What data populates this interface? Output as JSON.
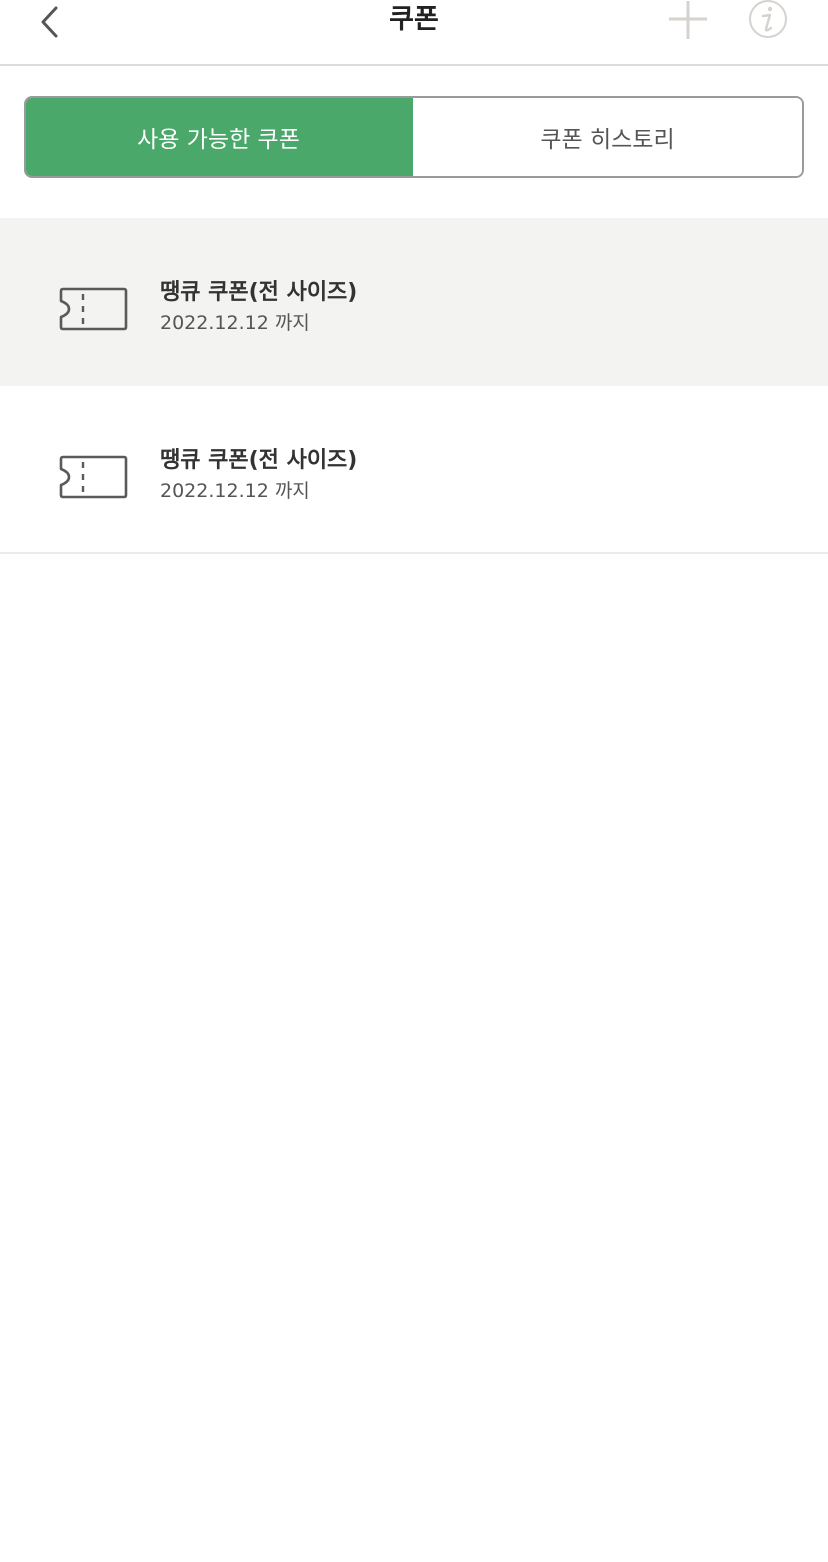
{
  "header": {
    "title": "쿠폰",
    "back_icon": "chevron-left-icon",
    "add_icon": "plus-icon",
    "info_icon": "info-icon"
  },
  "tabs": [
    {
      "label": "사용 가능한 쿠폰",
      "active": true
    },
    {
      "label": "쿠폰 히스토리",
      "active": false
    }
  ],
  "coupons": [
    {
      "name": "땡큐 쿠폰(전 사이즈)",
      "expiry": "2022.12.12 까지",
      "icon": "ticket-icon"
    },
    {
      "name": "땡큐 쿠폰(전 사이즈)",
      "expiry": "2022.12.12 까지",
      "icon": "ticket-icon"
    }
  ],
  "colors": {
    "accent": "#4aa86a",
    "highlight_bg": "#f3f3f2",
    "icon_gray": "#d6d2cd"
  }
}
